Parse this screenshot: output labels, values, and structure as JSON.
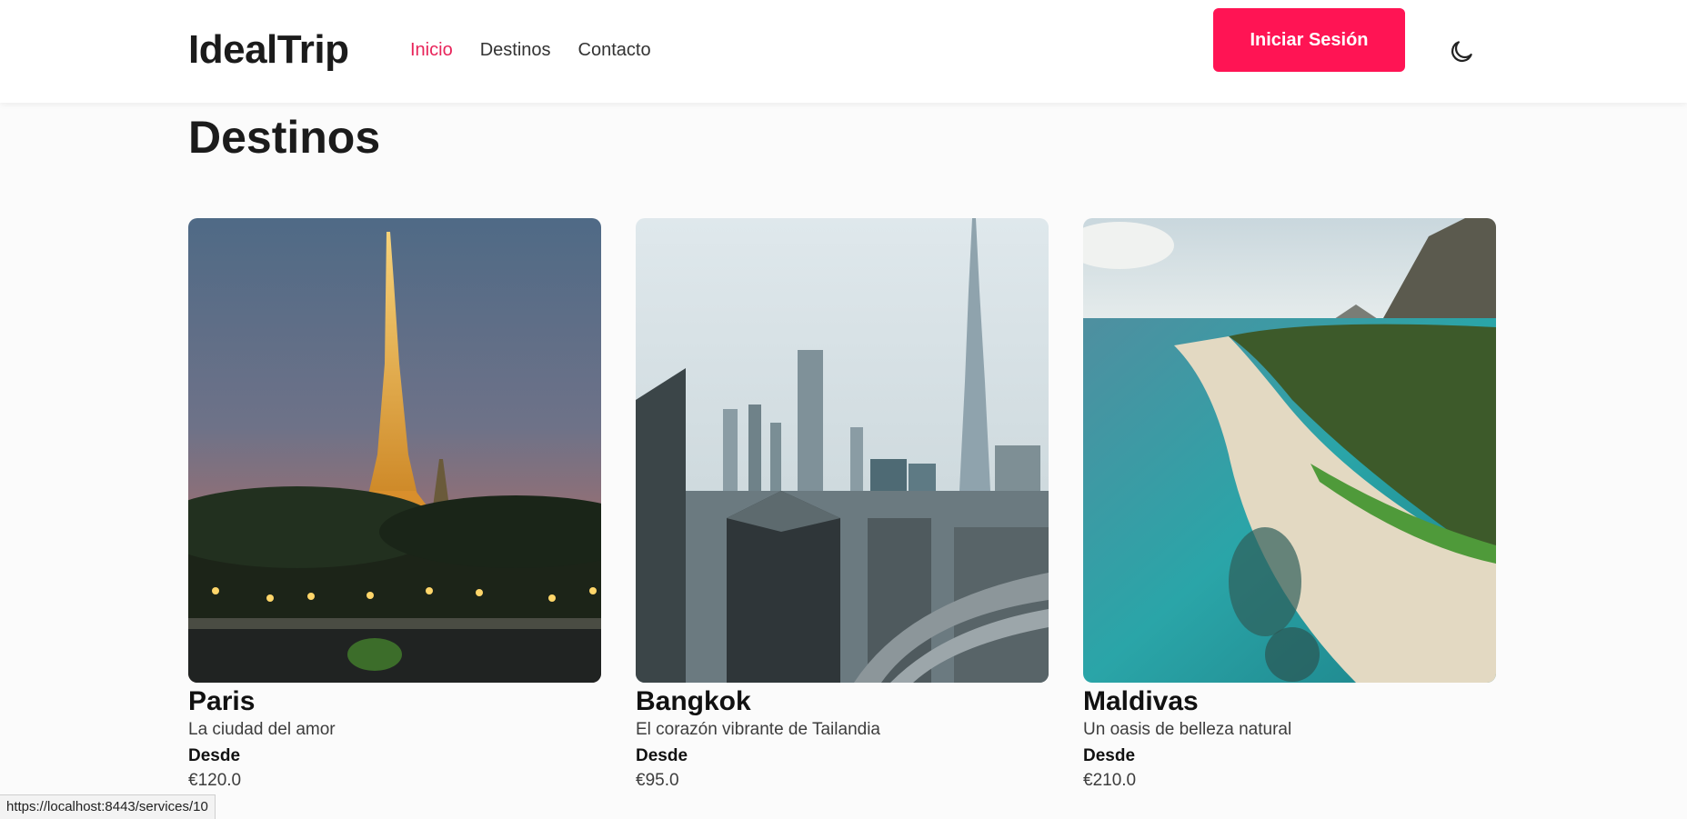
{
  "navbar": {
    "logo": "IdealTrip",
    "links": [
      {
        "label": "Inicio",
        "active": true
      },
      {
        "label": "Destinos",
        "active": false
      },
      {
        "label": "Contacto",
        "active": false
      }
    ],
    "login_label": "Iniciar Sesión",
    "theme_icon": "moon-icon"
  },
  "page": {
    "title": "Destinos"
  },
  "destinations": [
    {
      "name": "Paris",
      "description": "La ciudad del amor",
      "from_label": "Desde",
      "price": "€120.0",
      "image": "eiffel-tower-night-photo"
    },
    {
      "name": "Bangkok",
      "description": "El corazón vibrante de Tailandia",
      "from_label": "Desde",
      "price": "€95.0",
      "image": "city-skyline-photo"
    },
    {
      "name": "Maldivas",
      "description": "Un oasis de belleza natural",
      "from_label": "Desde",
      "price": "€210.0",
      "image": "tropical-beach-aerial-photo"
    }
  ],
  "status_bar": {
    "url": "https://localhost:8443/services/10"
  },
  "colors": {
    "accent": "#ff1454",
    "active_link": "#e8245a",
    "background": "#fbfbfb"
  }
}
